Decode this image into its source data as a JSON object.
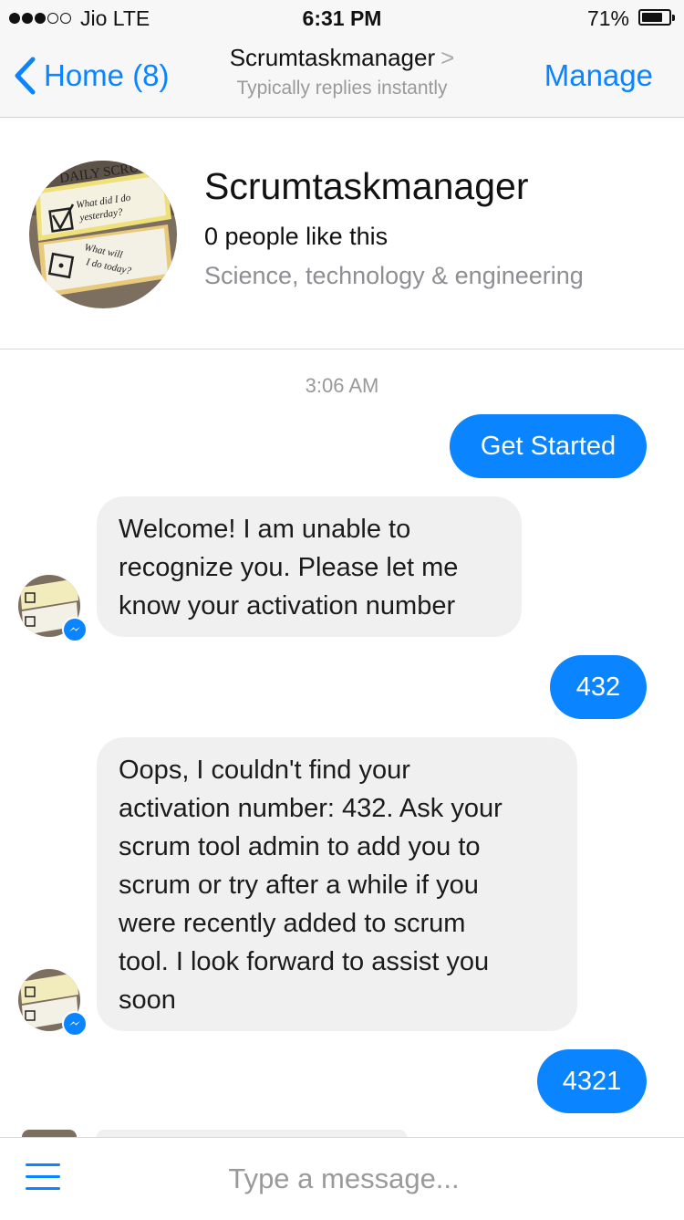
{
  "status_bar": {
    "carrier": "Jio  LTE",
    "time": "6:31 PM",
    "battery": "71%"
  },
  "nav": {
    "back_label": "Home (8)",
    "title": "Scrumtaskmanager",
    "title_chevron": ">",
    "subtitle": "Typically replies instantly",
    "manage_label": "Manage"
  },
  "profile": {
    "name": "Scrumtaskmanager",
    "likes": "0 people like this",
    "category": "Science, technology & engineering",
    "avatar_text": [
      "DAILY SCRUM",
      "What did I do",
      "yesterday?",
      "What will",
      "I do today?"
    ]
  },
  "chat": {
    "timestamp": "3:06 AM",
    "messages": [
      {
        "from": "me",
        "text": "Get Started"
      },
      {
        "from": "bot",
        "lines": [
          "Welcome! I am unable to",
          "recognize you. Please let me",
          "know your activation number"
        ]
      },
      {
        "from": "me",
        "text": "432"
      },
      {
        "from": "bot",
        "lines": [
          "Oops, I couldn't find your",
          "activation number: 432. Ask your",
          "scrum tool admin to add you to",
          "scrum or try after a while if you",
          "were recently added to scrum",
          "tool. I look forward to assist you",
          "soon"
        ]
      },
      {
        "from": "me",
        "text": "4321"
      }
    ]
  },
  "composer": {
    "placeholder": "Type a message..."
  },
  "colors": {
    "accent": "#0a84ff",
    "incoming_bubble": "#f0f0f0",
    "bar_bg": "#f7f7f7"
  }
}
